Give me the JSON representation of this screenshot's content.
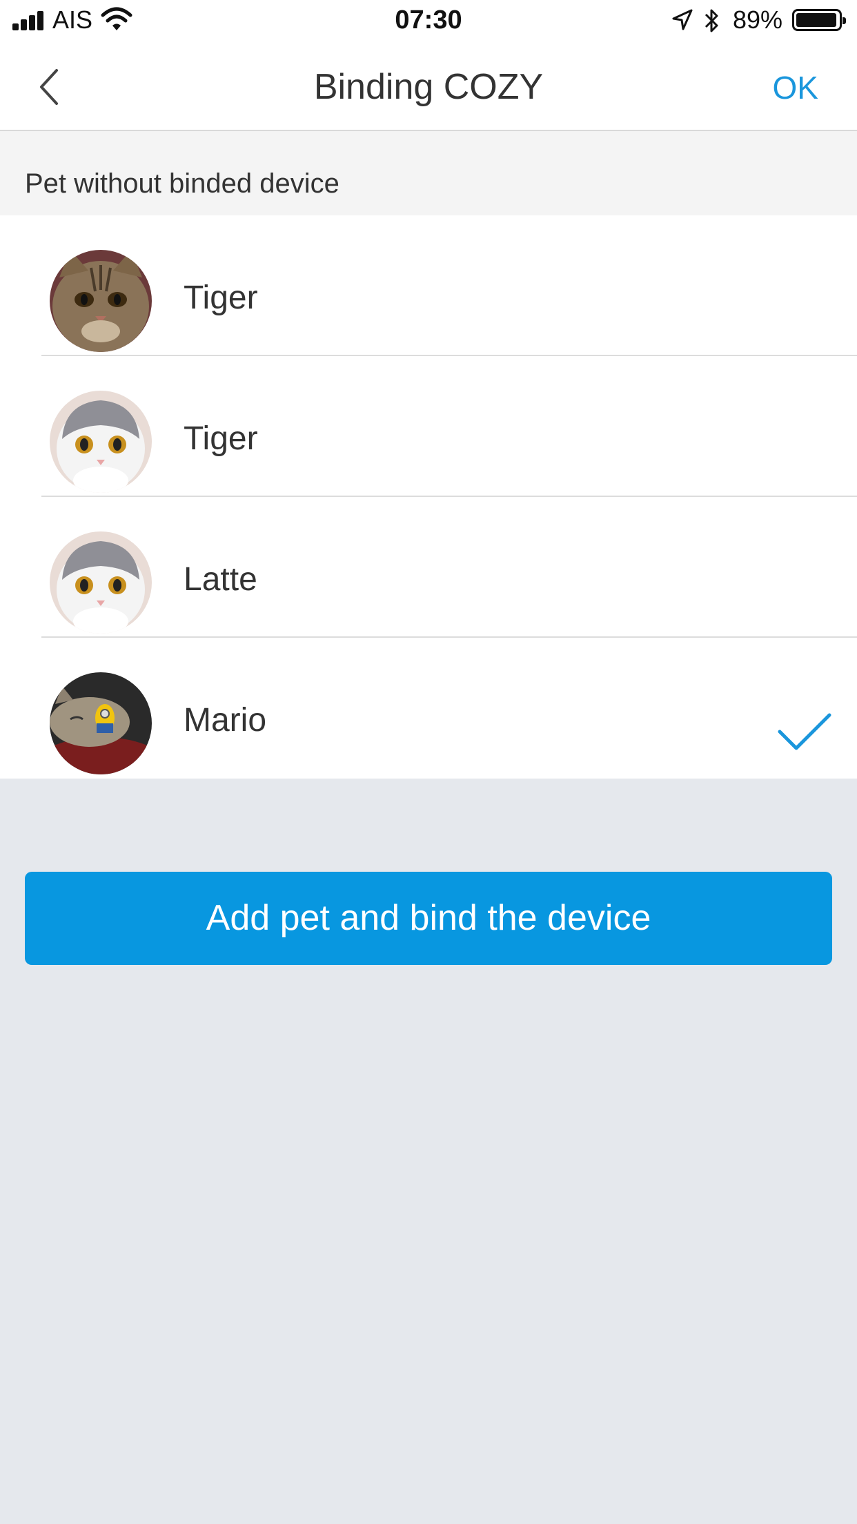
{
  "status_bar": {
    "carrier": "AIS",
    "time": "07:30",
    "battery_percent": "89%",
    "icons": [
      "signal-icon",
      "wifi-icon",
      "location-arrow-icon",
      "bluetooth-icon",
      "battery-icon"
    ]
  },
  "nav": {
    "title": "Binding COZY",
    "ok_label": "OK",
    "back_icon": "chevron-left-icon"
  },
  "section": {
    "header": "Pet without binded device"
  },
  "pets": [
    {
      "name": "Tiger",
      "selected": false,
      "avatar_icon": "tabby-cat-avatar"
    },
    {
      "name": "Tiger",
      "selected": false,
      "avatar_icon": "white-gray-cat-avatar"
    },
    {
      "name": "Latte",
      "selected": false,
      "avatar_icon": "white-gray-cat-avatar"
    },
    {
      "name": "Mario",
      "selected": true,
      "avatar_icon": "sleeping-cat-avatar"
    }
  ],
  "actions": {
    "add_button_label": "Add pet and bind the device"
  },
  "colors": {
    "accent": "#1a96dc",
    "button": "#0897e0",
    "background": "#e5e8ed"
  }
}
